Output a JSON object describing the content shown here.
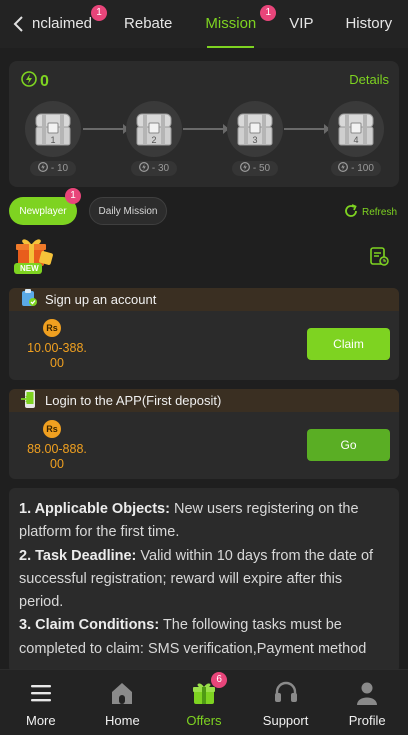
{
  "top_tabs": [
    {
      "label": "nclaimed",
      "badge": "1"
    },
    {
      "label": "Rebate",
      "badge": ""
    },
    {
      "label": "Mission",
      "badge": "1"
    },
    {
      "label": "VIP",
      "badge": ""
    },
    {
      "label": "History",
      "badge": ""
    }
  ],
  "active_tab": "Mission",
  "energy": {
    "value": "0",
    "details_label": "Details"
  },
  "chests": [
    {
      "number": "1",
      "cost": "- 10"
    },
    {
      "number": "2",
      "cost": "- 30"
    },
    {
      "number": "3",
      "cost": "- 50"
    },
    {
      "number": "4",
      "cost": "- 100"
    }
  ],
  "filters": {
    "newplayer_label": "Newplayer",
    "newplayer_badge": "1",
    "daily_label": "Daily Mission",
    "refresh_label": "Refresh"
  },
  "gift": {
    "tag": "NEW"
  },
  "tasks": [
    {
      "title": "Sign up an account",
      "coin": "Rs",
      "reward_line1": "10.00-388.",
      "reward_line2": "00",
      "button": "Claim"
    },
    {
      "title": "Login to the APP(First deposit)",
      "coin": "Rs",
      "reward_line1": "88.00-888.",
      "reward_line2": "00",
      "button": "Go"
    }
  ],
  "rules": [
    {
      "heading": "1. Applicable Objects:",
      "text": " New users registering on the platform for the first time."
    },
    {
      "heading": "2. Task Deadline:",
      "text": " Valid within 10 days from the date of successful registration; reward will expire after this period."
    },
    {
      "heading": "3. Claim Conditions:",
      "text": " The following tasks must be completed to claim: SMS verification,Payment method"
    }
  ],
  "bottom_nav": [
    {
      "label": "More",
      "icon": "menu-icon"
    },
    {
      "label": "Home",
      "icon": "home-icon"
    },
    {
      "label": "Offers",
      "icon": "gift-icon",
      "badge": "6"
    },
    {
      "label": "Support",
      "icon": "headset-icon"
    },
    {
      "label": "Profile",
      "icon": "person-icon"
    }
  ],
  "colors": {
    "accent": "#7ed321",
    "badge": "#e8457a",
    "reward": "#f0a020"
  }
}
